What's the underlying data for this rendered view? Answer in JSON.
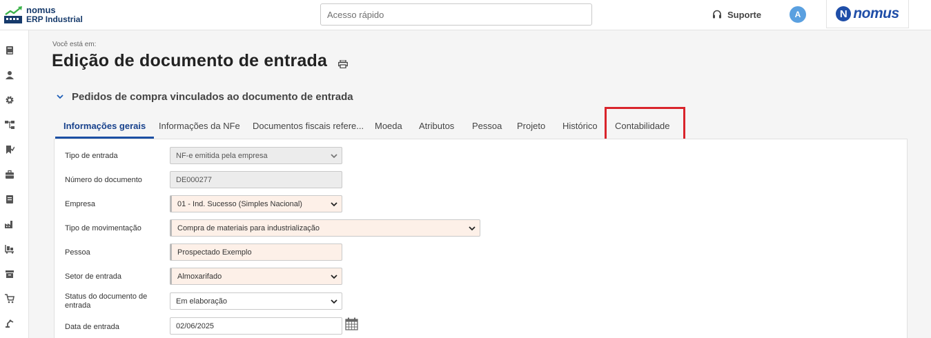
{
  "header": {
    "logo_line1": "nomus",
    "logo_line2": "ERP Industrial",
    "search_placeholder": "Acesso rápido",
    "support_label": "Suporte",
    "avatar_letter": "A",
    "brand_letter": "N",
    "brand_text": "nomus"
  },
  "sidebar": {
    "icons": [
      "book-icon",
      "user-icon",
      "gear-icon",
      "hierarchy-icon",
      "bookmark-check-icon",
      "briefcase-icon",
      "document-icon",
      "factory-icon",
      "pallet-icon",
      "archive-icon",
      "cart-icon",
      "robot-arm-icon"
    ]
  },
  "page": {
    "breadcrumb": "Você está em:",
    "title": "Edição de documento de entrada",
    "section_title": "Pedidos de compra vinculados ao documento de entrada"
  },
  "tabs": [
    {
      "label": "Informações gerais",
      "active": true
    },
    {
      "label": "Informações da NFe",
      "active": false
    },
    {
      "label": "Documentos fiscais refere...",
      "active": false
    },
    {
      "label": "Moeda",
      "active": false
    },
    {
      "label": "Atributos",
      "active": false
    },
    {
      "label": "Pessoa",
      "active": false
    },
    {
      "label": "Projeto",
      "active": false
    },
    {
      "label": "Histórico",
      "active": false
    },
    {
      "label": "Contabilidade",
      "active": false
    }
  ],
  "form": {
    "tipo_entrada": {
      "label": "Tipo de entrada",
      "value": "NF-e emitida pela empresa"
    },
    "numero_documento": {
      "label": "Número do documento",
      "value": "DE000277"
    },
    "empresa": {
      "label": "Empresa",
      "value": "01 - Ind. Sucesso (Simples Nacional)"
    },
    "tipo_movimentacao": {
      "label": "Tipo de movimentação",
      "value": "Compra de materiais para industrialização"
    },
    "pessoa": {
      "label": "Pessoa",
      "value": "Prospectado Exemplo"
    },
    "setor_entrada": {
      "label": "Setor de entrada",
      "value": "Almoxarifado"
    },
    "status_documento": {
      "label": "Status do documento de entrada",
      "value": "Em elaboração"
    },
    "data_entrada": {
      "label": "Data de entrada",
      "value": "02/06/2025"
    }
  },
  "colors": {
    "accent": "#1b4fa3",
    "highlight_box": "#d9242b",
    "required_bg": "#fdf0e8"
  }
}
